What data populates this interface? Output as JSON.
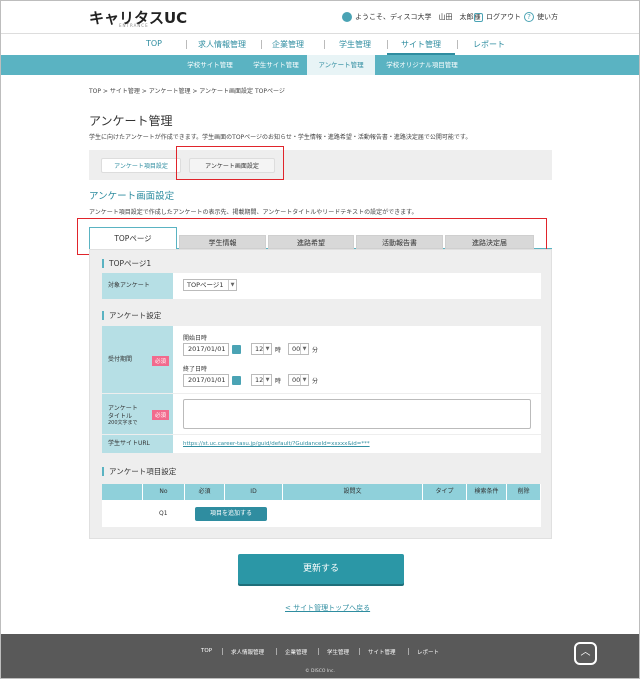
{
  "header": {
    "logo": "キャリタスUC",
    "logo_sub": "ENTRANCE",
    "welcome": "ようこそ、ディスコ大学　山田　太郎様",
    "logout": "ログアウト",
    "help": "使い方"
  },
  "main_nav": [
    "TOP",
    "求人情報管理",
    "企業管理",
    "学生管理",
    "サイト管理",
    "レポート"
  ],
  "main_nav_active": "サイト管理",
  "sub_nav": [
    "学校サイト管理",
    "学生サイト管理",
    "アンケート管理",
    "学校オリジナル項目管理"
  ],
  "sub_nav_active": "アンケート管理",
  "breadcrumb": "TOP > サイト管理 > アンケート管理 > アンケート画面設定 TOPページ",
  "page_title": "アンケート管理",
  "page_desc": "学生に向けたアンケートが作成できます。学生画面のTOPページのお知らせ・学生情報・進路希望・活動報告書・進路決定届で公開可能です。",
  "mode_tabs": [
    "アンケート項目設定",
    "アンケート画面設定"
  ],
  "section_title": "アンケート画面設定",
  "section_desc": "アンケート項目設定で作成したアンケートの表示先、掲載期間、アンケートタイトルやリードテキストの設定ができます。",
  "page_tabs": [
    "TOPページ",
    "学生情報",
    "進路希望",
    "活動報告書",
    "進路決定届"
  ],
  "page_tabs_active": "TOPページ",
  "top1": {
    "heading": "TOPページ1",
    "target_label": "対象アンケート",
    "target_value": "TOPページ1"
  },
  "settings": {
    "heading": "アンケート設定",
    "period_label": "受付期間",
    "required": "必須",
    "start_label": "開始日時",
    "start_date": "2017/01/01",
    "start_hour": "12",
    "start_min": "00",
    "end_label": "終了日時",
    "end_date": "2017/01/01",
    "end_hour": "12",
    "end_min": "00",
    "hour_unit": "時",
    "min_unit": "分",
    "title_label_1": "アンケート",
    "title_label_2": "タイトル",
    "title_label_3": "200文字まで",
    "title_value": "",
    "url_label": "学生サイトURL",
    "url_value": "https://st.uc.career-tasu.jp/guid/default/?GuidanceId=xxxxx&id=***"
  },
  "items": {
    "heading": "アンケート項目設定",
    "columns": [
      "No",
      "必須",
      "ID",
      "設問文",
      "タイプ",
      "検索条件",
      "削除"
    ],
    "row_no": "Q1",
    "add_button": "項目を追加する"
  },
  "update_button": "更新する",
  "back_link": "< サイト管理トップへ戻る",
  "footer": {
    "links": [
      "TOP",
      "求人情報管理",
      "企業管理",
      "学生管理",
      "サイト管理",
      "レポート"
    ],
    "copyright": "© DISCO Inc."
  },
  "colors": {
    "accent": "#2f8da0",
    "subnav": "#5ab3c2",
    "label_bg": "#b6dfe5",
    "required": "#f26a8d",
    "highlight": "#e0242b"
  }
}
